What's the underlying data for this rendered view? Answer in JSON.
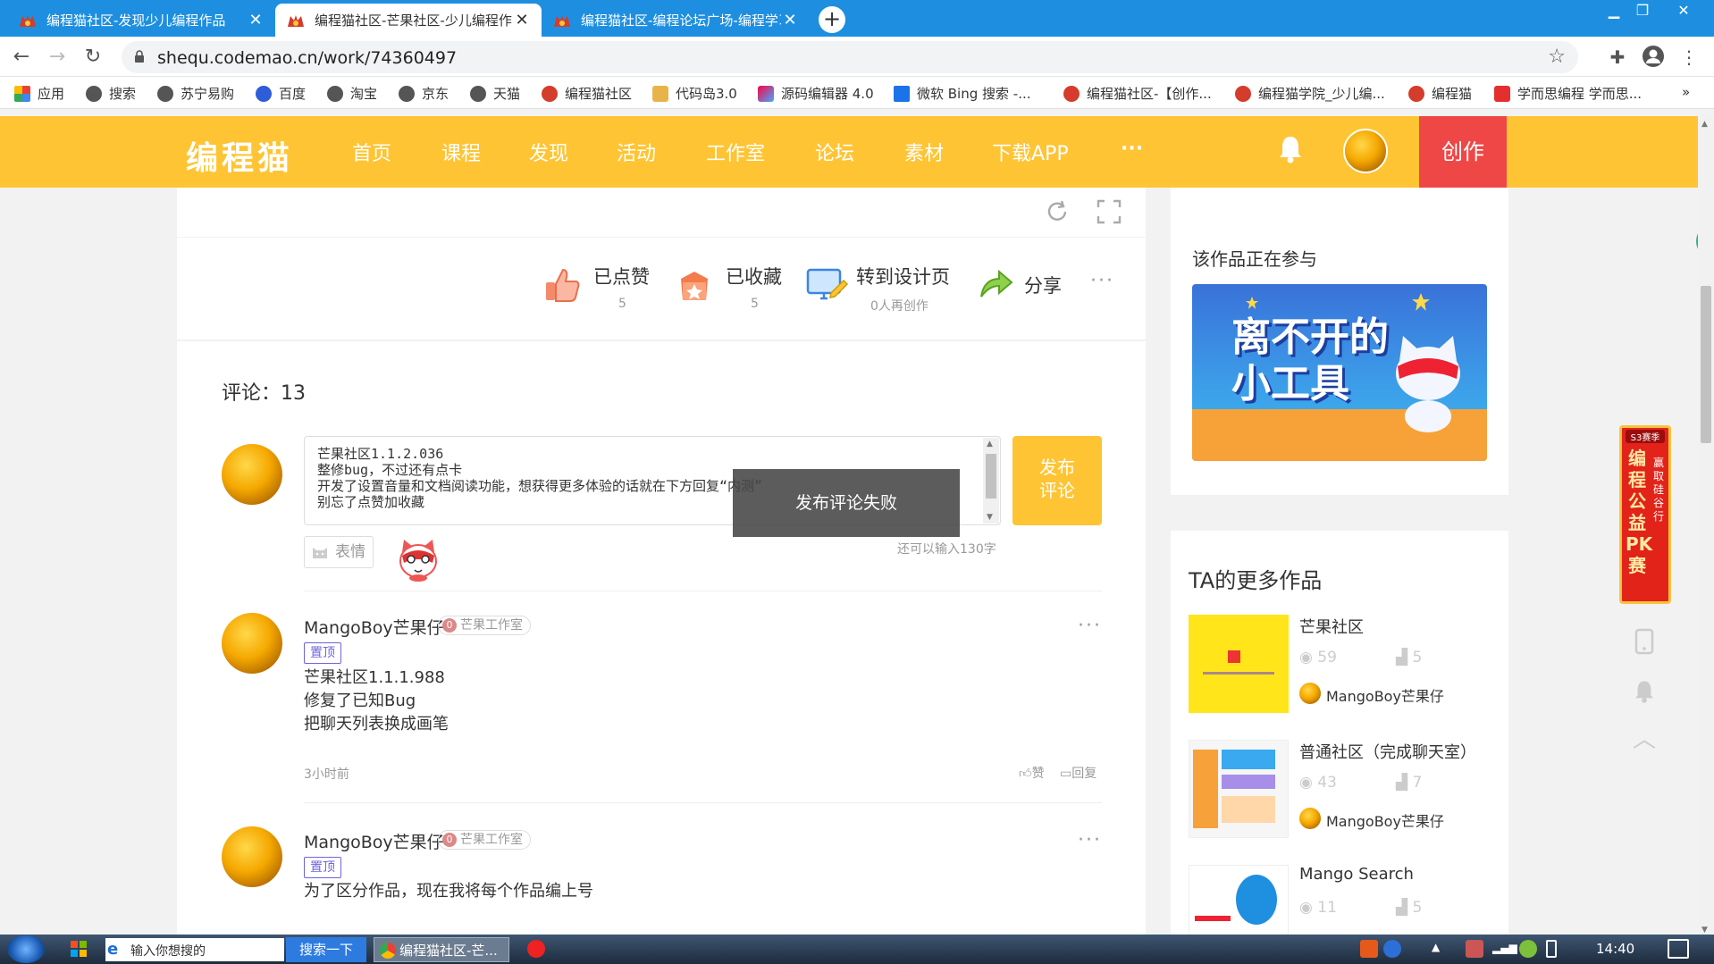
{
  "browser": {
    "tabs": [
      {
        "title": "编程猫社区-发现少儿编程作品"
      },
      {
        "title": "编程猫社区-芒果社区-少儿编程作品"
      },
      {
        "title": "编程猫社区-编程论坛广场-编程学习"
      }
    ],
    "url": "shequ.codemao.cn/work/74360497",
    "bookmarks": [
      "应用",
      "搜索",
      "苏宁易购",
      "百度",
      "淘宝",
      "京东",
      "天猫",
      "编程猫社区",
      "代码岛3.0",
      "源码编辑器 4.0",
      "微软 Bing 搜索 -...",
      "编程猫社区-【创作...",
      "编程猫学院_少儿编...",
      "编程猫",
      "学而思编程 学而思..."
    ],
    "bookmarks_more": "»"
  },
  "site": {
    "logo": "编程猫",
    "nav": [
      "首页",
      "课程",
      "发现",
      "活动",
      "工作室",
      "论坛",
      "素材",
      "下载APP"
    ],
    "nav_more": "···",
    "create_label": "创作"
  },
  "actions": {
    "liked": {
      "label": "已点赞",
      "count": "5"
    },
    "collected": {
      "label": "已收藏",
      "count": "5"
    },
    "design": {
      "label": "转到设计页",
      "count": "0人再创作"
    },
    "share": {
      "label": "分享"
    },
    "more": "···"
  },
  "comments_section": {
    "title": "评论：13",
    "input_value": "芒果社区1.1.2.036\n整修bug，不过还有点卡\n开发了设置音量和文档阅读功能，想获得更多体验的话就在下方回复“内测”\n别忘了点赞加收藏",
    "submit_label": "发布评论",
    "emoji_label": "表情",
    "remaining": "还可以输入130字",
    "toast": "发布评论失败",
    "comments": [
      {
        "name": "MangoBoy芒果仔",
        "studio": "芒果工作室",
        "studio_level": "0",
        "pinned": "置顶",
        "lines": [
          "芒果社区1.1.1.988",
          "修复了已知Bug",
          "把聊天列表换成画笔"
        ],
        "time": "3小时前",
        "like": "赞",
        "reply": "回复"
      },
      {
        "name": "MangoBoy芒果仔",
        "studio": "芒果工作室",
        "studio_level": "0",
        "pinned": "置顶",
        "lines": [
          "为了区分作品，现在我将每个作品编上号"
        ]
      }
    ]
  },
  "sidebar": {
    "participating_title": "该作品正在参与",
    "banner_text": "离不开的小工具",
    "more_works_title": "TA的更多作品",
    "works": [
      {
        "name": "芒果社区",
        "views": "59",
        "likes": "5",
        "author": "MangoBoy芒果仔"
      },
      {
        "name": "普通社区（完成聊天室）",
        "views": "43",
        "likes": "7",
        "author": "MangoBoy芒果仔"
      },
      {
        "name": "Mango Search",
        "views": "11",
        "likes": "5"
      }
    ],
    "promo": {
      "badge": "S3赛季",
      "title": "编程公益PK赛",
      "subtitle": "赢取硅谷行"
    }
  },
  "taskbar": {
    "search_placeholder": "输入你想搜的",
    "search_button": "搜索一下",
    "active_window": "编程猫社区-芒...",
    "clock": "14:40"
  },
  "colors": {
    "brand_yellow": "#fec433",
    "create_red": "#ef4746",
    "pin_purple": "#6f64d9",
    "chrome_blue": "#1e8fe0"
  }
}
